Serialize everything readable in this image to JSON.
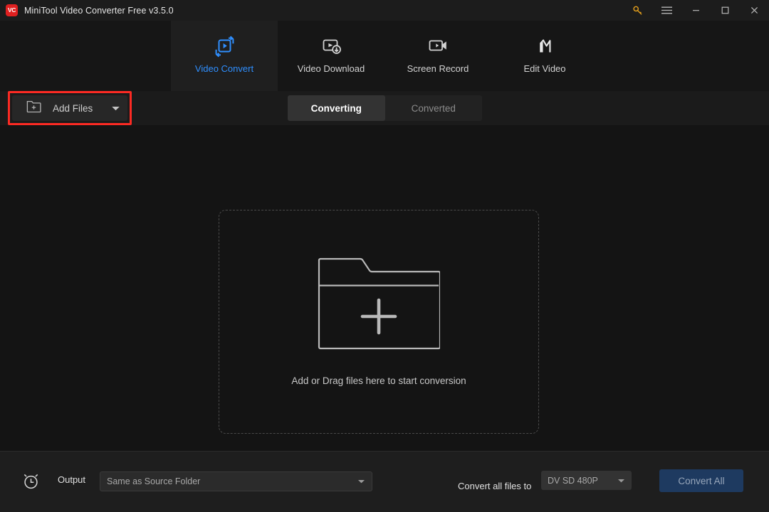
{
  "window": {
    "title": "MiniTool Video Converter Free v3.5.0",
    "logo_text": "VC",
    "controls": [
      {
        "name": "key-icon",
        "label": "Register"
      },
      {
        "name": "hamburger-menu-icon",
        "label": "Menu"
      },
      {
        "name": "minimize-icon",
        "label": "Minimize"
      },
      {
        "name": "maximize-icon",
        "label": "Maximize"
      },
      {
        "name": "close-icon",
        "label": "Close"
      }
    ]
  },
  "nav": {
    "tabs": [
      {
        "label": "Video Convert",
        "icon": "video-convert-icon",
        "active": true
      },
      {
        "label": "Video Download",
        "icon": "video-download-icon",
        "active": false
      },
      {
        "label": "Screen Record",
        "icon": "screen-record-icon",
        "active": false
      },
      {
        "label": "Edit Video",
        "icon": "edit-video-icon",
        "active": false
      }
    ]
  },
  "toolbar": {
    "add_files_label": "Add Files",
    "add_files_icon": "folder-plus-icon",
    "add_files_caret": "chevron-down-icon",
    "tabs": [
      {
        "label": "Converting",
        "active": true
      },
      {
        "label": "Converted",
        "active": false
      }
    ]
  },
  "main": {
    "dropzone_icon": "folder-plus-large-icon",
    "dropzone_text": "Add or Drag files here to start conversion"
  },
  "bottom": {
    "clock_icon": "alarm-clock-icon",
    "output_label": "Output",
    "output_value": "Same as Source Folder",
    "convert_to_label": "Convert all files to",
    "format_value": "DV SD 480P",
    "convert_all_label": "Convert All"
  },
  "colors": {
    "accent_blue": "#2f8fff",
    "brand_red": "#e02020",
    "highlight_red": "#fb2a23",
    "key_gold": "#e6a11c",
    "convert_button": "#1e3a60",
    "window_bg": "#141414",
    "titlebar_bg": "#1c1c1c",
    "bottombar_bg": "#1e1e1e"
  }
}
